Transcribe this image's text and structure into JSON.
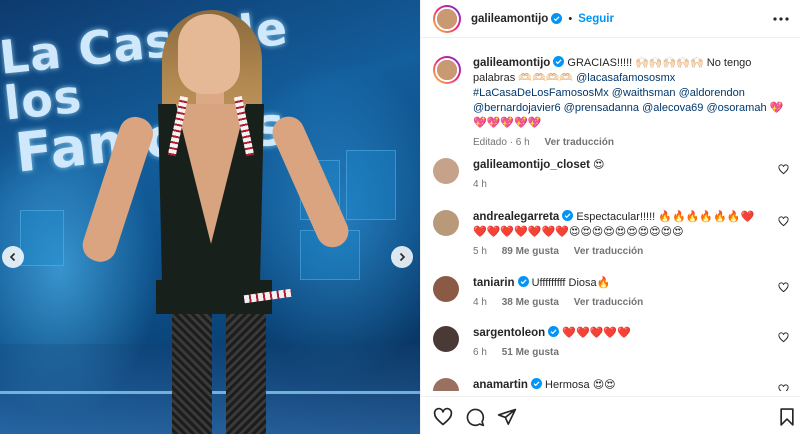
{
  "post": {
    "author": "galileamontijo",
    "follow_label": "Seguir",
    "dot": "•"
  },
  "caption": {
    "username": "galileamontijo",
    "text": "GRACIAS!!!!! 🙌🏻🙌🏻🙌🏻🙌🏻🙌🏻 No tengo palabras 🫶🏻🫶🏻🫶🏻🫶🏻",
    "mention1": "@lacasafamososmx",
    "hashtag": "#LaCasaDeLosFamososMx",
    "mentions_rest": "@waithsman @aldorendon @bernardojavier6 @prensadanna @alecova69 @osoramah",
    "hearts": "💖💖💖💖💖💖",
    "edited": "Editado · 6 h",
    "translate": "Ver traducción"
  },
  "comments": [
    {
      "username": "galileamontijo_closet",
      "text": "😍",
      "time": "4 h",
      "likes": "",
      "translate": "",
      "avatar_color": "#c7a28a"
    },
    {
      "username": "andrealegarreta",
      "text": "Espectacular!!!!! 🔥🔥🔥🔥🔥🔥❤️❤️❤️❤️❤️❤️❤️❤️😍😍😍😍😍😍😍😍😍😍",
      "time": "5 h",
      "likes": "89 Me gusta",
      "translate": "Ver traducción",
      "avatar_color": "#b89a7a"
    },
    {
      "username": "taniarin",
      "text": "Ufffffffff Diosa🔥",
      "time": "4 h",
      "likes": "38 Me gusta",
      "translate": "Ver traducción",
      "avatar_color": "#8a5a44"
    },
    {
      "username": "sargentoleon",
      "text": "❤️❤️❤️❤️❤️",
      "time": "6 h",
      "likes": "51 Me gusta",
      "translate": "",
      "avatar_color": "#4a3a36"
    },
    {
      "username": "anamartin",
      "text": "Hermosa 😍😍",
      "time": "",
      "likes": "",
      "translate": "",
      "avatar_color": "#9a7060"
    }
  ],
  "photo": {
    "logo_line1": "La Casa de los",
    "logo_line2": "Famosos"
  },
  "icons": {
    "verified": "verified-badge-icon",
    "more": "more-options-icon",
    "like": "heart-icon",
    "comment": "comment-icon",
    "share": "share-icon",
    "save": "bookmark-icon",
    "prev": "chevron-left-icon",
    "next": "chevron-right-icon"
  },
  "colors": {
    "accent": "#0095f6",
    "verified": "#0095f6",
    "link": "#00376b",
    "muted": "#737373"
  }
}
